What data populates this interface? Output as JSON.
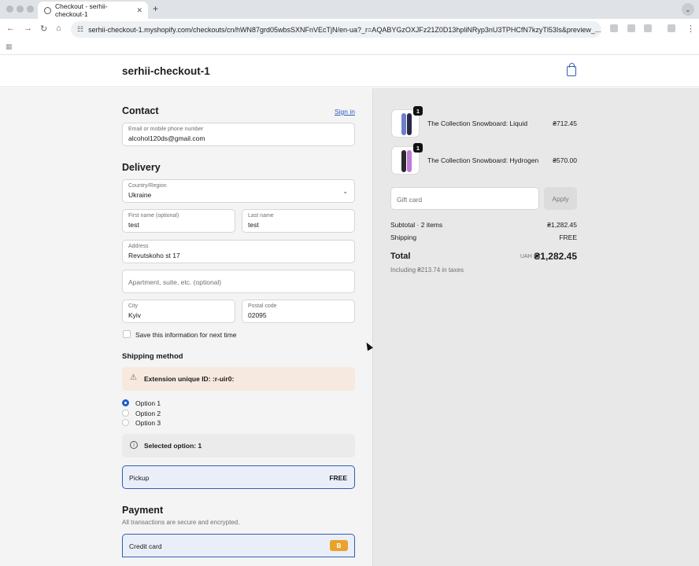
{
  "browser": {
    "tab_title": "Checkout - serhii-checkout-1",
    "new_tab": "+",
    "url": "serhii-checkout-1.myshopify.com/checkouts/cn/hWN87grd05wbsSXNFnVEcTjN/en-ua?_r=AQABYGzOXJFz21Z0D13hpliNRyp3nU3TPHCfN7kzyTl53Is&preview_..."
  },
  "header": {
    "shop_name": "serhii-checkout-1"
  },
  "contact": {
    "heading": "Contact",
    "sign_in": "Sign in",
    "email_label": "Email or mobile phone number",
    "email_value": "alcohol120ds@gmail.com"
  },
  "delivery": {
    "heading": "Delivery",
    "country_label": "Country/Region",
    "country_value": "Ukraine",
    "first_name_label": "First name (optional)",
    "first_name_value": "test",
    "last_name_label": "Last name",
    "last_name_value": "test",
    "address_label": "Address",
    "address_value": "Revutskoho st 17",
    "apartment_placeholder": "Apartment, suite, etc. (optional)",
    "city_label": "City",
    "city_value": "Kyiv",
    "postal_label": "Postal code",
    "postal_value": "02095",
    "save_info": "Save this information for next time"
  },
  "shipping": {
    "heading": "Shipping method",
    "warning": "Extension unique ID: :r-uir0:",
    "options": [
      "Option 1",
      "Option 2",
      "Option 3"
    ],
    "selected_info": "Selected option: 1",
    "method_name": "Pickup",
    "method_price": "FREE"
  },
  "payment": {
    "heading": "Payment",
    "subtitle": "All transactions are secure and encrypted.",
    "method": "Credit card",
    "card_logo": "B"
  },
  "summary": {
    "items": [
      {
        "name": "The Collection Snowboard: Liquid",
        "qty": "1",
        "price": "₴712.45",
        "color1": "#6d7fc8",
        "color2": "#2a2a4a"
      },
      {
        "name": "The Collection Snowboard: Hydrogen",
        "qty": "1",
        "price": "₴570.00",
        "color1": "#2a2a2a",
        "color2": "#c07ad8"
      }
    ],
    "gift_placeholder": "Gift card",
    "apply": "Apply",
    "subtotal_label": "Subtotal · 2 items",
    "subtotal_value": "₴1,282.45",
    "shipping_label": "Shipping",
    "shipping_value": "FREE",
    "total_label": "Total",
    "currency": "UAH",
    "total_value": "₴1,282.45",
    "taxes": "Including ₴213.74 in taxes"
  }
}
